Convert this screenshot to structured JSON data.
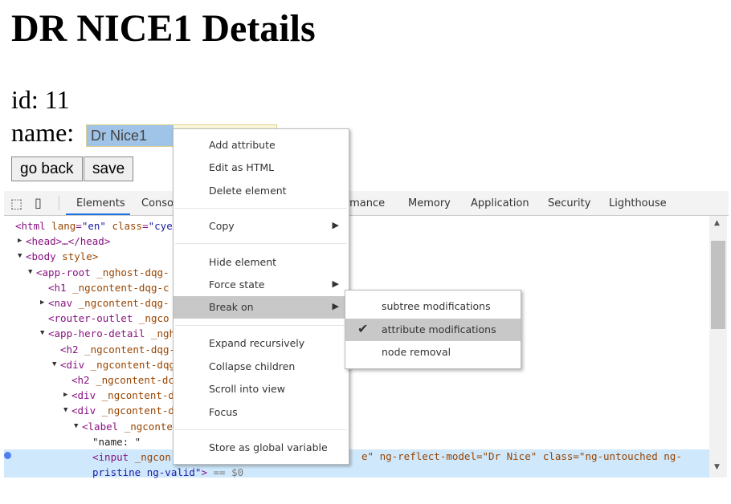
{
  "page": {
    "title": "DR NICE1 Details",
    "id_label": "id: 11",
    "name_label": "name:",
    "name_value": "Dr Nice1",
    "go_back": "go back",
    "save": "save"
  },
  "devtools": {
    "tabs": [
      "Elements",
      "Conso",
      "rmance",
      "Memory",
      "Application",
      "Security",
      "Lighthouse"
    ],
    "active_tab": "Elements",
    "tree": [
      "<html lang=\"en\" class=\"cye",
      "<head>…</head>",
      "<body style>",
      "<app-root _nghost-dqg-",
      "<h1 _ngcontent-dqg-c",
      "<nav _ngcontent-dqg-",
      "<router-outlet _ngco",
      "<app-hero-detail _ngh",
      "<h2 _ngcontent-dqg-",
      "<div _ngcontent-dqg",
      "<h2 _ngcontent-dc",
      "<div _ngcontent-d",
      "<div _ngcontent-d",
      "<label _ngconte",
      "\"name: \"",
      "<input _ngcon",
      "pristine ng-valid\"> == $0"
    ],
    "selected_tail": "e\" ng-reflect-model=\"Dr Nice\" class=\"ng-untouched ng-"
  },
  "context_menu": {
    "items": [
      "Add attribute",
      "Edit as HTML",
      "Delete element",
      "Copy",
      "Hide element",
      "Force state",
      "Break on",
      "Expand recursively",
      "Collapse children",
      "Scroll into view",
      "Focus",
      "Store as global variable"
    ],
    "highlighted": "Break on"
  },
  "submenu": {
    "items": [
      "subtree modifications",
      "attribute modifications",
      "node removal"
    ],
    "checked": "attribute modifications"
  },
  "colors": {
    "tag": "#881280",
    "attr_name": "#994500",
    "attr_value": "#1a1aa6",
    "selected_row": "#cfe8fc",
    "menu_highlight": "#c8c8c8"
  }
}
